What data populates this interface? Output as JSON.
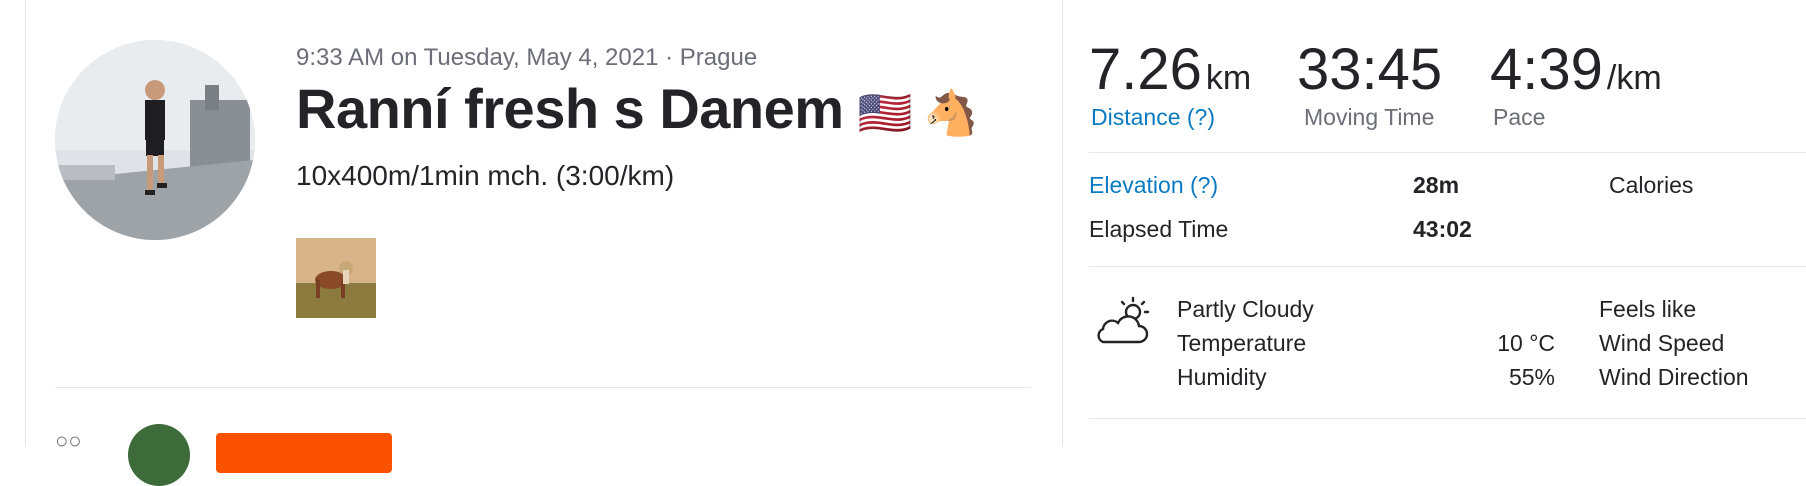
{
  "activity": {
    "datetime_location": "9:33 AM on Tuesday, May 4, 2021 · Prague",
    "title": "Ranní fresh s Danem",
    "title_emojis": "🇺🇸 🐴",
    "description": "10x400m/1min mch. (3:00/km)"
  },
  "stats": {
    "distance": {
      "value": "7.26",
      "unit": "km",
      "label": "Distance (?)"
    },
    "moving_time": {
      "value": "33:45",
      "label": "Moving Time"
    },
    "pace": {
      "value": "4:39",
      "unit": "/km",
      "label": "Pace"
    }
  },
  "details": {
    "elevation": {
      "label": "Elevation (?)",
      "value": "28m"
    },
    "calories": {
      "label": "Calories"
    },
    "elapsed": {
      "label": "Elapsed Time",
      "value": "43:02"
    }
  },
  "weather": {
    "condition": "Partly Cloudy",
    "temperature_label": "Temperature",
    "temperature_value": "10 °C",
    "humidity_label": "Humidity",
    "humidity_value": "55%",
    "feels_like_label": "Feels like",
    "wind_speed_label": "Wind Speed",
    "wind_direction_label": "Wind Direction",
    "icon": "partly-cloudy-icon"
  },
  "colors": {
    "link": "#0a7bc3",
    "accent": "#fc5200",
    "muted": "#6d6d78"
  }
}
